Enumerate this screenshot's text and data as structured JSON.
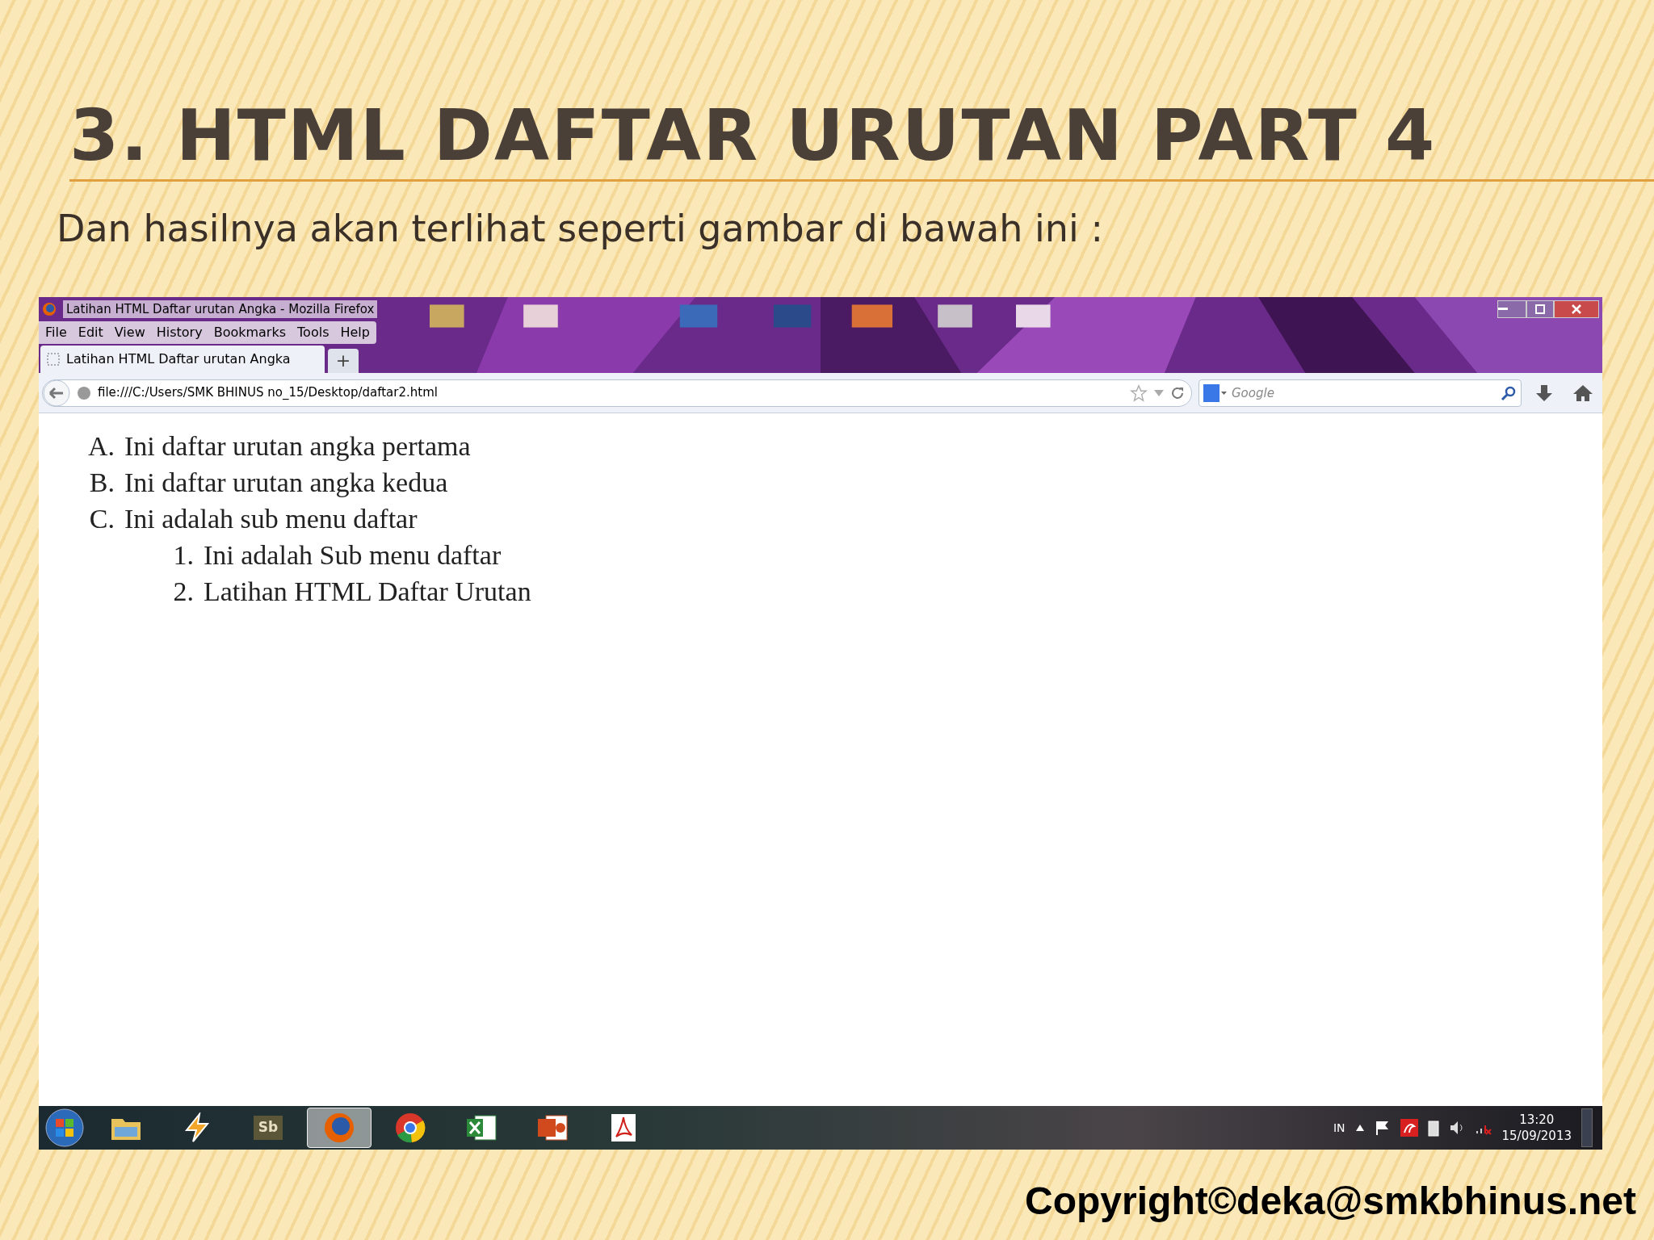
{
  "slide": {
    "title": "3. HTML DAFTAR URUTAN PART 4",
    "subtitle": "Dan hasilnya akan terlihat seperti gambar di bawah ini :",
    "copyright": "Copyright©deka@smkbhinus.net"
  },
  "browser": {
    "window_title": "Latihan HTML Daftar urutan Angka - Mozilla Firefox",
    "menu": [
      "File",
      "Edit",
      "View",
      "History",
      "Bookmarks",
      "Tools",
      "Help"
    ],
    "tabs": [
      {
        "label": "Latihan HTML Daftar urutan Angka",
        "selected": true
      }
    ],
    "new_tab": "+",
    "url": "file:///C:/Users/SMK BHINUS no_15/Desktop/daftar2.html",
    "search": {
      "placeholder": "Google"
    },
    "list": [
      {
        "marker": "A.",
        "text": "Ini daftar urutan angka pertama"
      },
      {
        "marker": "B.",
        "text": "Ini daftar urutan angka kedua"
      },
      {
        "marker": "C.",
        "text": "Ini adalah sub menu daftar",
        "children": [
          {
            "marker": "1.",
            "text": "Ini adalah Sub menu daftar"
          },
          {
            "marker": "2.",
            "text": "Latihan HTML Daftar Urutan"
          }
        ]
      }
    ]
  },
  "taskbar": {
    "apps": [
      {
        "kind": "folder",
        "selected": false
      },
      {
        "kind": "bolt",
        "selected": false
      },
      {
        "kind": "sb",
        "label": "Sb",
        "selected": false
      },
      {
        "kind": "firefox",
        "selected": true
      },
      {
        "kind": "chrome",
        "selected": false
      },
      {
        "kind": "excel",
        "selected": false
      },
      {
        "kind": "powerpoint",
        "selected": false
      },
      {
        "kind": "pdf",
        "selected": false
      }
    ],
    "language": "IN",
    "time": "13:20",
    "date": "15/09/2013"
  }
}
